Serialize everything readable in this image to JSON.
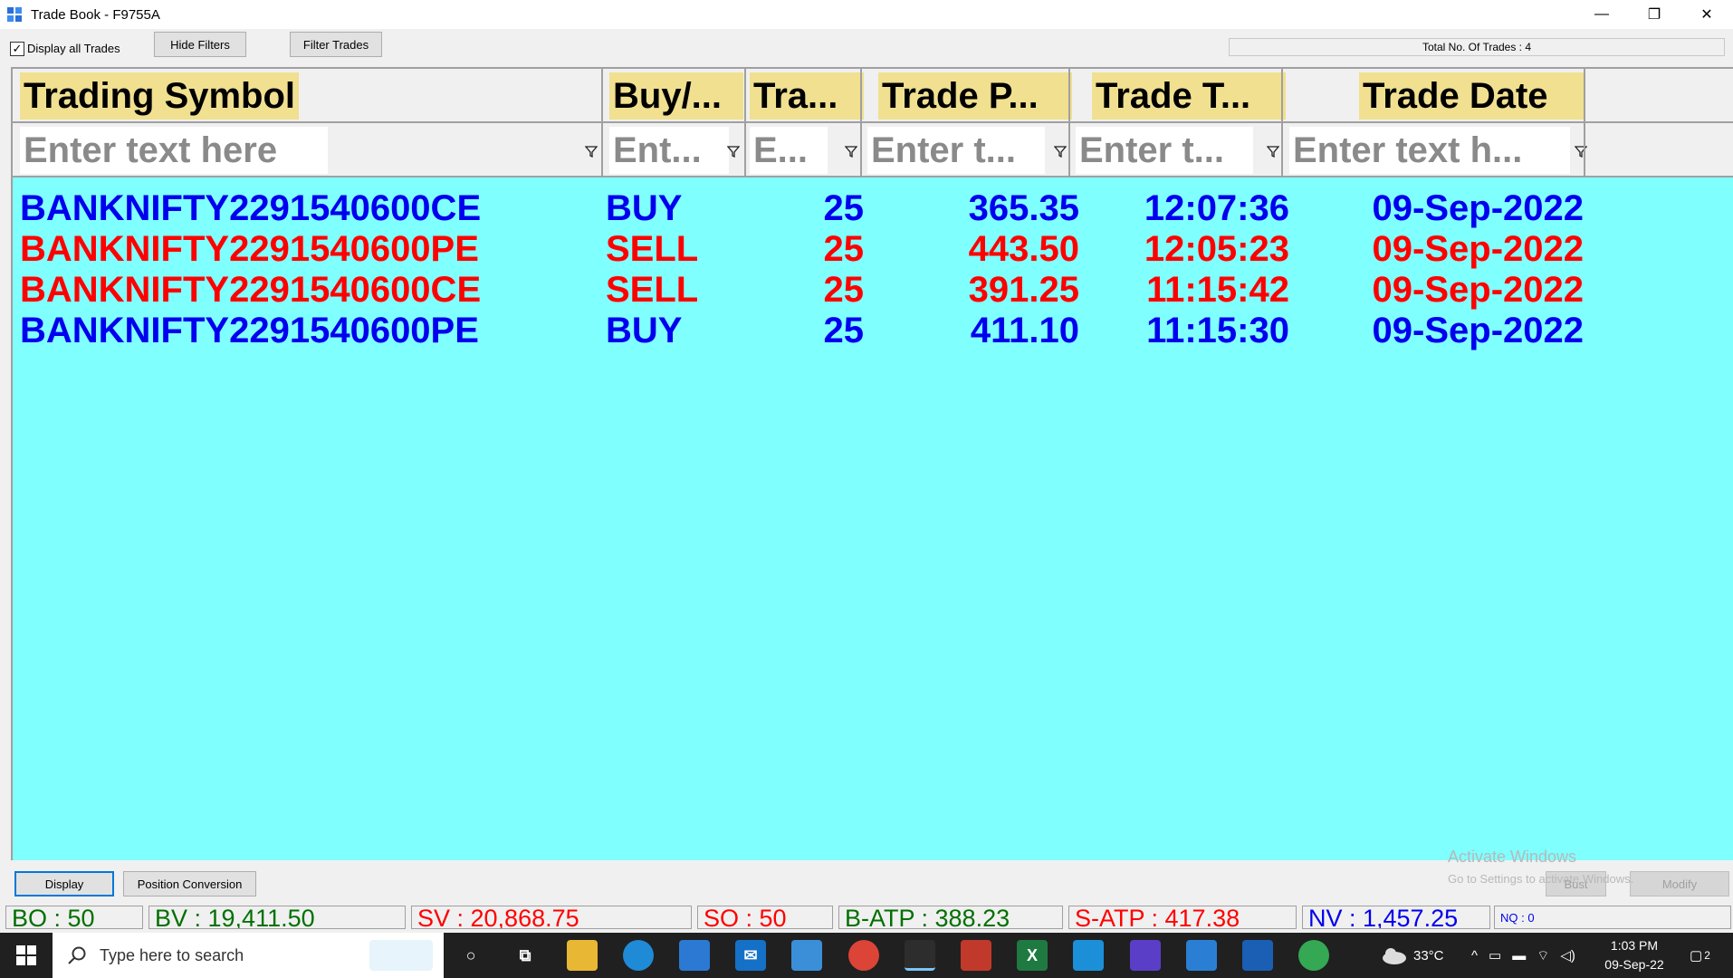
{
  "window": {
    "title": "Trade Book - F9755A",
    "minimize": "—",
    "maximize": "❐",
    "close": "✕"
  },
  "toolbar": {
    "display_all_checked": "✓",
    "display_all_label": "Display all Trades",
    "hide_filters": "Hide Filters",
    "filter_trades": "Filter Trades",
    "total_trades": "Total No. Of Trades : 4"
  },
  "grid": {
    "headers": [
      "Trading Symbol",
      "Buy/...",
      "Tra...",
      "Trade P...",
      "Trade T...",
      "Trade Date"
    ],
    "filters": [
      "Enter text here",
      "Ent...",
      "E...",
      "Enter t...",
      "Enter t...",
      "Enter text h..."
    ],
    "rows": [
      {
        "symbol": "BANKNIFTY2291540600CE",
        "side": "BUY",
        "qty": "25",
        "price": "365.35",
        "time": "12:07:36",
        "date": "09-Sep-2022"
      },
      {
        "symbol": "BANKNIFTY2291540600PE",
        "side": "SELL",
        "qty": "25",
        "price": "443.50",
        "time": "12:05:23",
        "date": "09-Sep-2022"
      },
      {
        "symbol": "BANKNIFTY2291540600CE",
        "side": "SELL",
        "qty": "25",
        "price": "391.25",
        "time": "11:15:42",
        "date": "09-Sep-2022"
      },
      {
        "symbol": "BANKNIFTY2291540600PE",
        "side": "BUY",
        "qty": "25",
        "price": "411.10",
        "time": "11:15:30",
        "date": "09-Sep-2022"
      }
    ]
  },
  "bottom": {
    "display": "Display",
    "position_conversion": "Position Conversion",
    "bust": "Bust",
    "modify": "Modify",
    "watermark_title": "Activate Windows",
    "watermark_sub": "Go to Settings to activate Windows."
  },
  "status": {
    "bo": "BO : 50",
    "bv": "BV : 19,411.50",
    "sv": "SV : 20,868.75",
    "so": "SO : 50",
    "batp": "B-ATP : 388.23",
    "satp": "S-ATP : 417.38",
    "nv": "NV : 1,457.25",
    "nq": "NQ : 0"
  },
  "taskbar": {
    "search_placeholder": "Type here to search",
    "temperature": "33°C",
    "time": "1:03 PM",
    "date": "09-Sep-22",
    "notifications": "2"
  },
  "colors": {
    "grid_bg": "#80ffff",
    "buy": "#0000ee",
    "sell": "#ff0000",
    "header_bg": "#f0e090"
  }
}
